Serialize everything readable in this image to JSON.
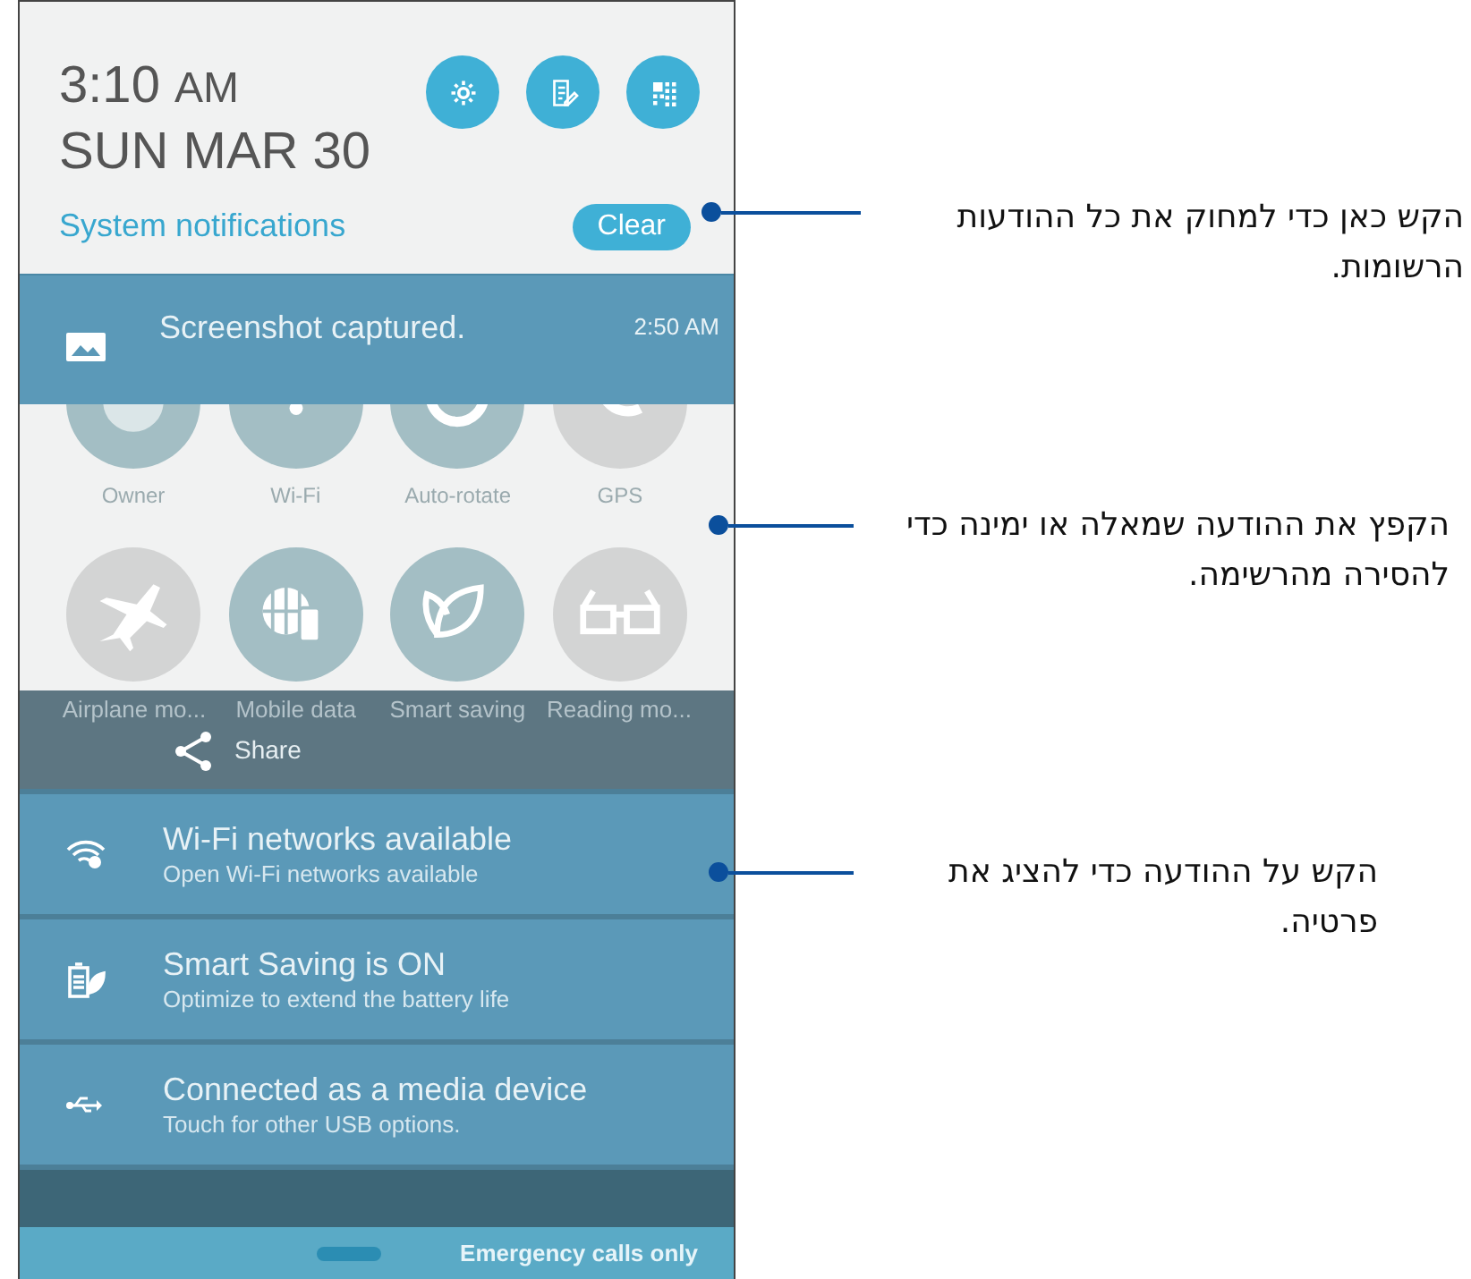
{
  "header": {
    "time": "3:10",
    "ampm": "AM",
    "date": "SUN MAR 30",
    "section_label": "System notifications",
    "clear_button": "Clear"
  },
  "header_buttons": [
    {
      "kind": "settings"
    },
    {
      "kind": "edit"
    },
    {
      "kind": "apps"
    }
  ],
  "screenshot_notification": {
    "title": "Screenshot captured.",
    "time": "2:50 AM"
  },
  "quick_settings_rows": [
    [
      {
        "label": "Owner",
        "kind": "owner",
        "on": true
      },
      {
        "label": "Wi-Fi",
        "kind": "wifi",
        "on": true
      },
      {
        "label": "Auto-rotate",
        "kind": "rotate",
        "on": true
      },
      {
        "label": "GPS",
        "kind": "gps",
        "on": false
      }
    ],
    [
      {
        "label": "Airplane mo...",
        "kind": "airplane",
        "on": false
      },
      {
        "label": "Mobile data",
        "kind": "globe",
        "on": true
      },
      {
        "label": "Smart saving",
        "kind": "leaf",
        "on": true
      },
      {
        "label": "Reading mo...",
        "kind": "glasses",
        "on": false
      }
    ]
  ],
  "share_action": "Share",
  "notifications": [
    {
      "kind": "wifi",
      "title": "Wi-Fi networks available",
      "text": "Open Wi-Fi networks available"
    },
    {
      "kind": "battery",
      "title": "Smart Saving is ON",
      "text": "Optimize to extend the battery life"
    },
    {
      "kind": "usb",
      "title": "Connected as a media device",
      "text": "Touch for other USB options."
    }
  ],
  "status_bar": {
    "text": "Emergency calls only"
  },
  "callouts": [
    {
      "text": "הקש כאן כדי למחוק את כל ההודעות הרשומות."
    },
    {
      "text": "הקפץ את ההודעה שמאלה או ימינה כדי להסירה מהרשימה."
    },
    {
      "text": "הקש על ההודעה כדי להציג את פרטיה."
    }
  ]
}
